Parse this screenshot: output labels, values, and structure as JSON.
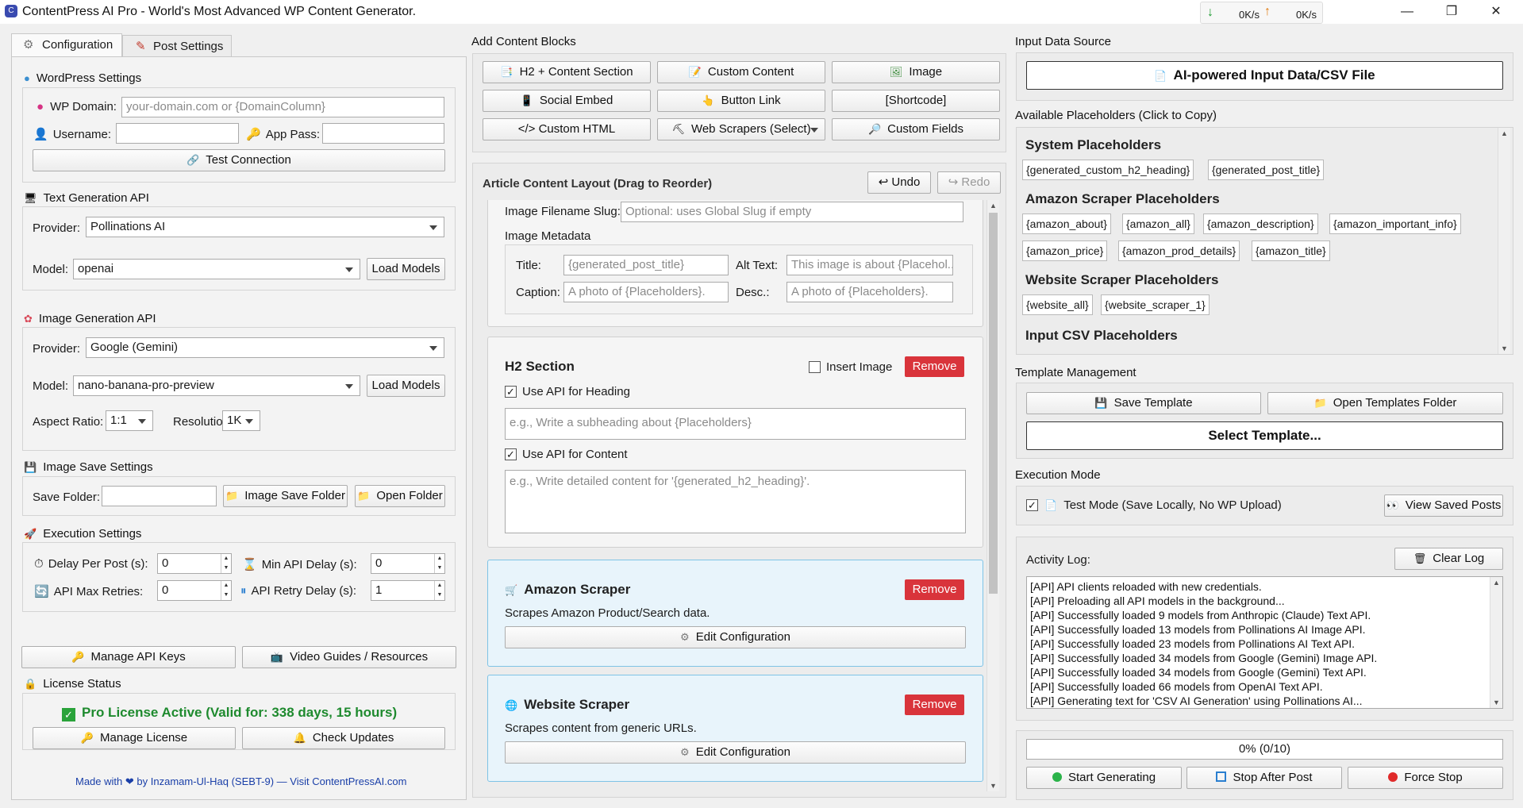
{
  "window": {
    "title": "ContentPress AI Pro - World's Most Advanced WP Content Generator.",
    "net_down": "0K/s",
    "net_up": "0K/s"
  },
  "tabs": [
    "Configuration",
    "Post Settings"
  ],
  "wp": {
    "header": "WordPress Settings",
    "domain_label": "WP Domain:",
    "domain_placeholder": "your-domain.com or {DomainColumn}",
    "username_label": "Username:",
    "apppass_label": "App Pass:",
    "test_button": "Test Connection"
  },
  "textgen": {
    "header": "Text Generation API",
    "provider_label": "Provider:",
    "provider_value": "Pollinations AI",
    "model_label": "Model:",
    "model_value": "openai",
    "load_button": "Load Models"
  },
  "imagegen": {
    "header": "Image Generation API",
    "provider_label": "Provider:",
    "provider_value": "Google (Gemini)",
    "model_label": "Model:",
    "model_value": "nano-banana-pro-preview",
    "load_button": "Load Models",
    "aspect_label": "Aspect Ratio:",
    "aspect_value": "1:1",
    "res_label": "Resolution:",
    "res_value": "1K"
  },
  "imagesave": {
    "header": "Image Save Settings",
    "folder_label": "Save Folder:",
    "save_folder_button": "Image Save Folder",
    "open_folder_button": "Open Folder"
  },
  "exec": {
    "header": "Execution Settings",
    "delay_label": "Delay Per Post (s):",
    "delay_value": "0",
    "min_delay_label": "Min API Delay (s):",
    "min_delay_value": "0",
    "retries_label": "API Max Retries:",
    "retries_value": "0",
    "retry_delay_label": "API Retry Delay (s):",
    "retry_delay_value": "1"
  },
  "bottom_left": {
    "manage_keys": "Manage API Keys",
    "video_guides": "Video Guides / Resources",
    "license_header": "License Status",
    "license_text": "Pro License Active (Valid for: 338 days, 15 hours)",
    "manage_license": "Manage License",
    "check_updates": "Check Updates",
    "footer_prefix": "Made with",
    "footer_suffix": "by Inzamam-Ul-Haq (SEBT-9) — Visit ContentPressAI.com"
  },
  "blocks": {
    "header": "Add Content Blocks",
    "buttons": [
      "H2 + Content Section",
      "Custom Content",
      "Image",
      "Social Embed",
      "Button Link",
      "[Shortcode]",
      "</> Custom HTML",
      "Web Scrapers (Select)",
      "Custom Fields"
    ]
  },
  "layout": {
    "header": "Article Content Layout (Drag to Reorder)",
    "undo": "↩ Undo",
    "redo": "↪ Redo",
    "image_slug_label": "Image Filename Slug:",
    "image_slug_placeholder": "Optional: uses Global Slug if empty",
    "metadata_label": "Image Metadata",
    "title_label": "Title:",
    "title_placeholder": "{generated_post_title}",
    "alt_label": "Alt Text:",
    "alt_placeholder": "This image is about {Placehol...",
    "caption_label": "Caption:",
    "caption_placeholder": "A photo of {Placeholders}.",
    "desc_label": "Desc.:",
    "desc_placeholder": "A photo of {Placeholders}.",
    "h2": {
      "title": "H2 Section",
      "insert_image": "Insert Image",
      "remove": "Remove",
      "use_api_heading": "Use API for Heading",
      "heading_placeholder": "e.g., Write a subheading about {Placeholders}",
      "use_api_content": "Use API for Content",
      "content_placeholder": "e.g., Write detailed content for '{generated_h2_heading}'."
    },
    "amazon": {
      "title": "Amazon Scraper",
      "remove": "Remove",
      "desc": "Scrapes Amazon Product/Search data.",
      "edit": "Edit Configuration"
    },
    "website": {
      "title": "Website Scraper",
      "remove": "Remove",
      "desc": "Scrapes content from generic URLs.",
      "edit": "Edit Configuration"
    }
  },
  "input": {
    "header": "Input Data Source",
    "button": "AI-powered Input Data/CSV File"
  },
  "placeholders": {
    "header": "Available Placeholders (Click to Copy)",
    "system_title": "System Placeholders",
    "system": [
      "{generated_custom_h2_heading}",
      "{generated_post_title}"
    ],
    "amazon_title": "Amazon Scraper Placeholders",
    "amazon": [
      "{amazon_about}",
      "{amazon_all}",
      "{amazon_description}",
      "{amazon_important_info}",
      "{amazon_price}",
      "{amazon_prod_details}",
      "{amazon_title}"
    ],
    "website_title": "Website Scraper Placeholders",
    "website": [
      "{website_all}",
      "{website_scraper_1}"
    ],
    "csv_title": "Input CSV Placeholders"
  },
  "template": {
    "header": "Template Management",
    "save": "Save Template",
    "open": "Open Templates Folder",
    "select": "Select Template..."
  },
  "execmode": {
    "header": "Execution Mode",
    "test_mode": "Test Mode (Save Locally, No WP Upload)",
    "view_saved": "View Saved Posts"
  },
  "log": {
    "header": "Activity Log:",
    "clear": "Clear Log",
    "lines": [
      "[API] API clients reloaded with new credentials.",
      "[API] Preloading all API models in the background...",
      "[API] Successfully loaded 9 models from Anthropic (Claude) Text API.",
      "[API] Successfully loaded 13 models from Pollinations AI Image API.",
      "[API] Successfully loaded 23 models from Pollinations AI Text API.",
      "[API] Successfully loaded 34 models from Google (Gemini) Image API.",
      "[API] Successfully loaded 34 models from Google (Gemini) Text API.",
      "[API] Successfully loaded 66 models from OpenAI Text API.",
      "[API] Generating text for 'CSV AI Generation' using Pollinations AI..."
    ]
  },
  "progress": {
    "text": "0% (0/10)",
    "fraction": 0
  },
  "controls": {
    "start": "Start Generating",
    "stop_after": "Stop After Post",
    "force_stop": "Force Stop"
  },
  "colors": {
    "remove": "#d9343b",
    "license_green": "#1e8a2e",
    "scraper_bg": "#e8f4fb"
  }
}
